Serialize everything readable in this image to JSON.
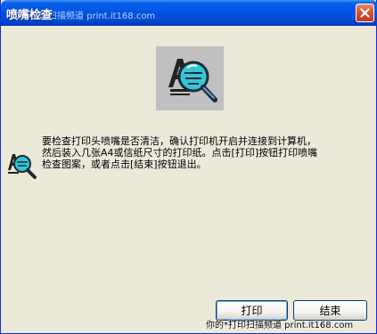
{
  "window": {
    "title": "喷嘴检查",
    "title_watermark": "你的*打印扫描频道 print.it168.com"
  },
  "icons": {
    "close": "close-icon",
    "hero": "nozzle-check-magnifier-icon",
    "small": "nozzle-check-magnifier-icon"
  },
  "message": {
    "text": "要检查打印头喷嘴是否清洁，确认打印机开启并连接到计算机，\n然后装入几张A4或信纸尺寸的打印纸。点击[打印]按钮打印喷嘴\n检查图案，或者点击[结束]按钮退出。"
  },
  "buttons": {
    "print_label": "打印",
    "end_label": "结束"
  },
  "watermark_bottom": "你的*打印扫描频道 print.it168.com",
  "colors": {
    "titlebar": "#0054e3",
    "close": "#d6512e",
    "dialog_bg": "#ece9d8"
  }
}
